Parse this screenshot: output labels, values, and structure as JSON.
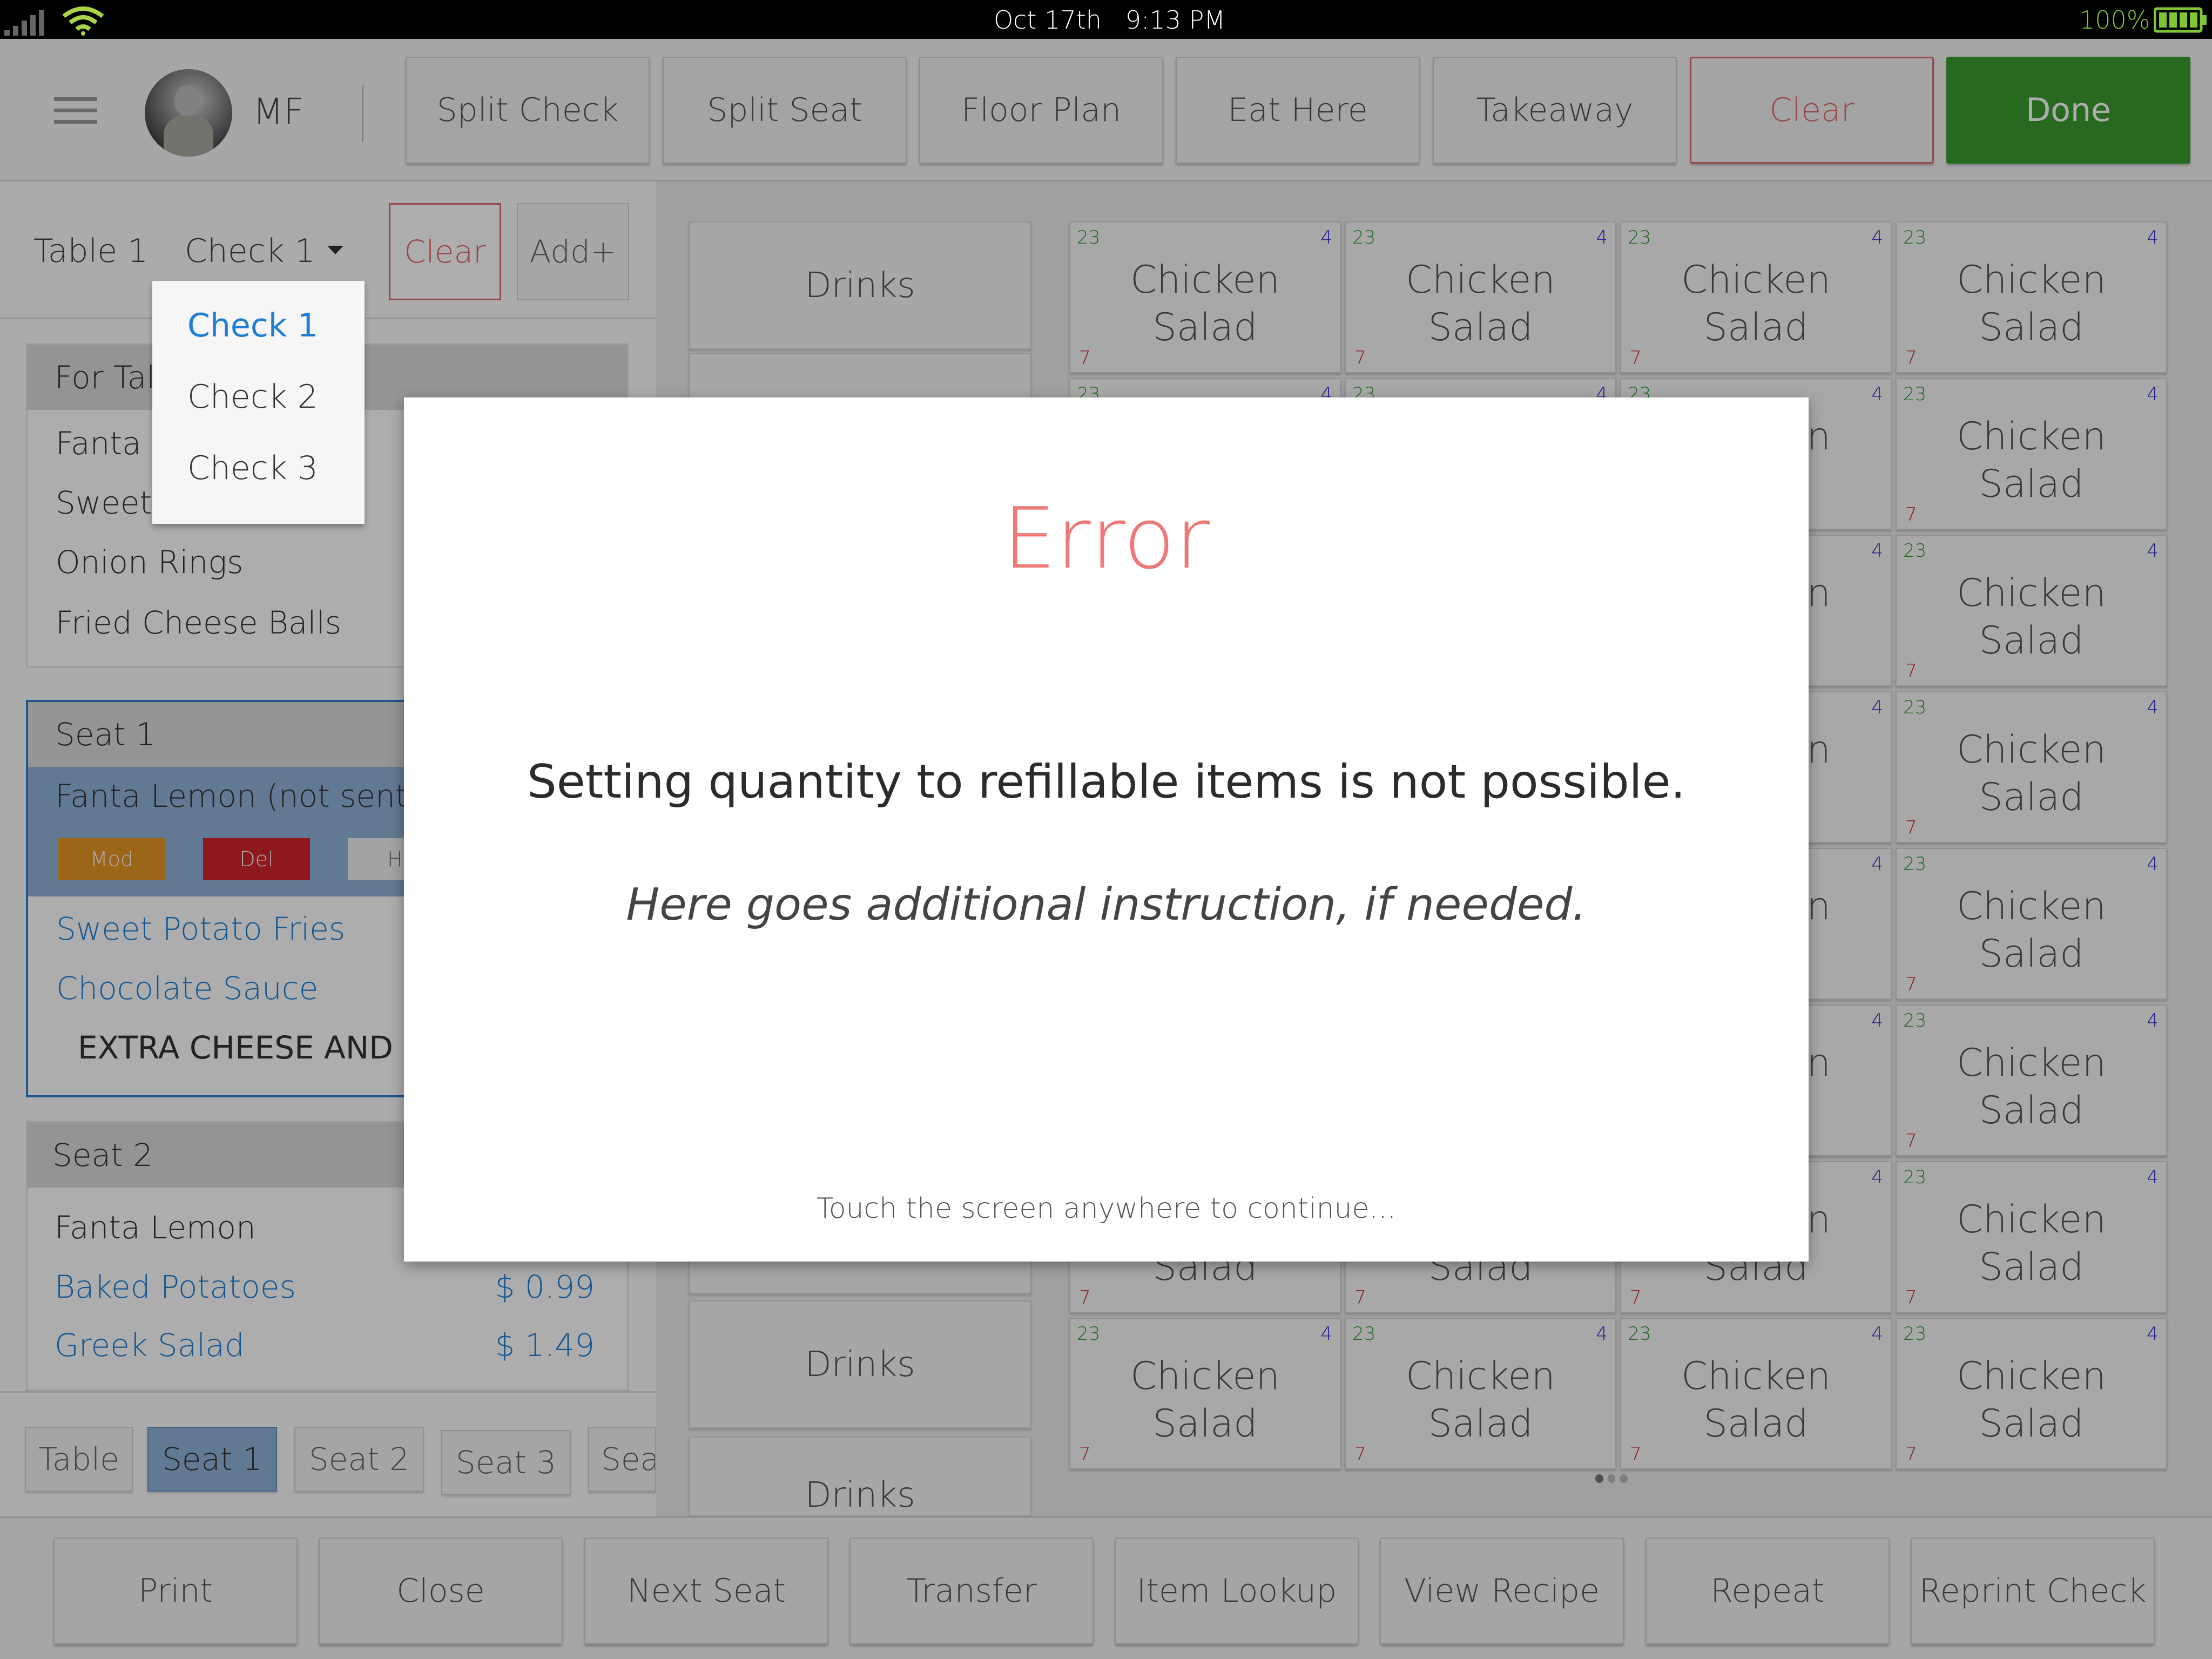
{
  "status_bar": {
    "date": "Oct 17th",
    "time": "9:13 PM",
    "battery": "100%",
    "colors": {
      "battery": "#7ec636",
      "wifi": "#a9d44a"
    }
  },
  "header": {
    "initials": "MF",
    "buttons": [
      {
        "label": "Split Check"
      },
      {
        "label": "Split Seat"
      },
      {
        "label": "Floor Plan"
      },
      {
        "label": "Eat Here"
      },
      {
        "label": "Takeaway"
      }
    ],
    "clear_label": "Clear",
    "done_label": "Done",
    "colors": {
      "done": "#3a9b2e",
      "clear": "#e06b6b"
    }
  },
  "check_bar": {
    "table_label": "Table 1",
    "check_selected": "Check 1",
    "clear_label": "Clear",
    "add_label": "Add+",
    "dropdown": [
      "Check 1",
      "Check 2",
      "Check 3"
    ]
  },
  "order": {
    "for_table": {
      "title": "For Tal",
      "items": [
        "Fanta L",
        "Sweet",
        "Onion Rings",
        "Fried Cheese Balls"
      ]
    },
    "seat1": {
      "title": "Seat 1",
      "selected_item": "Fanta Lemon (not sent)",
      "actions": [
        "Mod",
        "Del",
        "Ho"
      ],
      "items": [
        "Sweet Potato Fries",
        "Chocolate Sauce"
      ],
      "note": "EXTRA CHEESE AND L"
    },
    "seat2": {
      "title": "Seat 2",
      "items": [
        {
          "name": "Fanta Lemon",
          "price": ""
        },
        {
          "name": "Baked Potatoes",
          "price": "$ 0.99"
        },
        {
          "name": "Greek Salad",
          "price": "$ 1.49"
        }
      ]
    }
  },
  "seat_tabs": [
    "Table",
    "Seat 1",
    "Seat 2",
    "Seat 3",
    "Sea"
  ],
  "categories": [
    "Drinks",
    "Drinks",
    "Drinks"
  ],
  "menu_tile": {
    "name": "Chicken\nSalad",
    "top_left": "23",
    "top_right": "4",
    "bottom_left": "7"
  },
  "footer": {
    "buttons": [
      {
        "label": "Print"
      },
      {
        "label": "Close"
      },
      {
        "label": "Next Seat"
      },
      {
        "label": "Transfer"
      },
      {
        "label": "Item Lookup"
      },
      {
        "label": "View Recipe"
      },
      {
        "label": "Repeat"
      },
      {
        "label": "Reprint Check"
      }
    ]
  },
  "modal": {
    "title": "Error",
    "message": "Setting quantity to refillable items is not possible.",
    "instruction": "Here goes additional instruction, if needed.",
    "footer": "Touch the screen anywhere to continue...",
    "title_color": "#ee7a77"
  }
}
